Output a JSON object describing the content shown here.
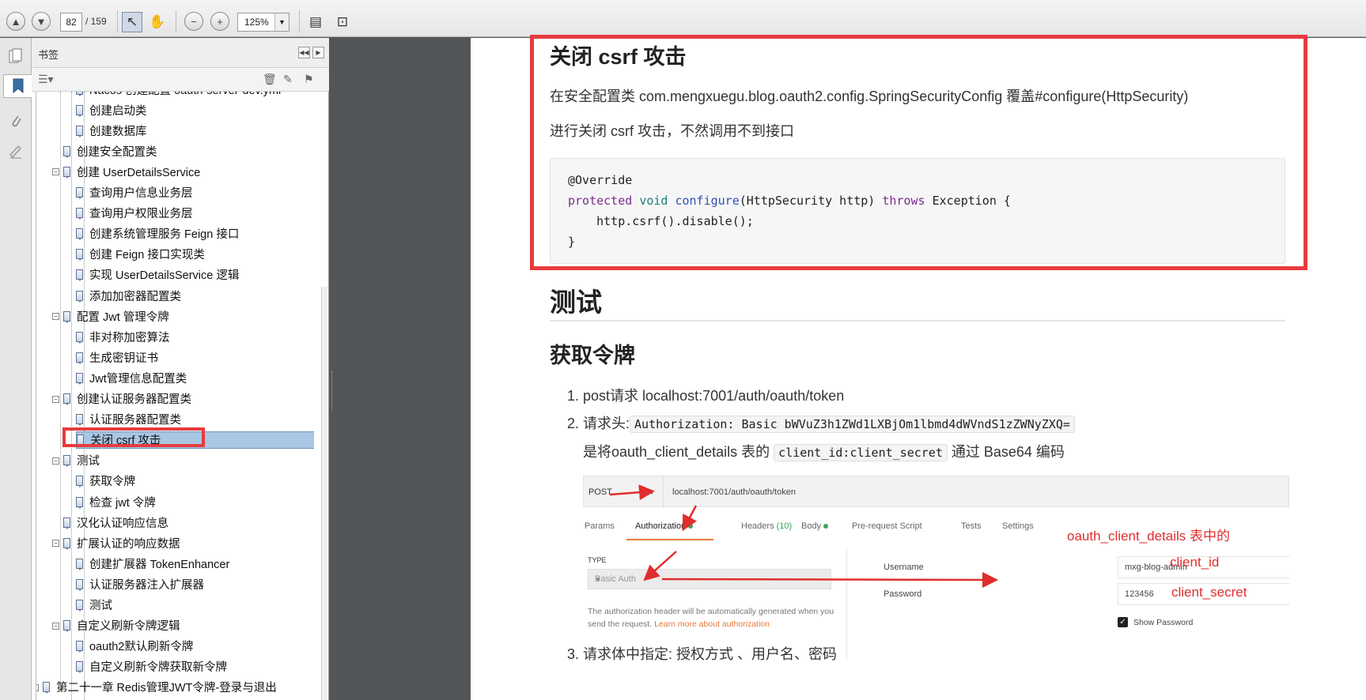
{
  "toolbar": {
    "page_current": "82",
    "page_total": "/ 159",
    "zoom": "125%",
    "zoom_caret": "▼",
    "up_glyph": "▲",
    "down_glyph": "▼",
    "select_glyph": "↖",
    "hand_glyph": "✋",
    "zoom_out_glyph": "−",
    "zoom_in_glyph": "+",
    "fit_page_glyph": "▤",
    "fit_width_glyph": "⊡"
  },
  "rail": {
    "icons": [
      "pages-icon",
      "bookmark-icon",
      "attachment-icon",
      "signature-icon"
    ]
  },
  "bookmarks": {
    "title": "书签",
    "collapse_glyph": "◀◀",
    "expand_glyph": "▶",
    "options_glyph": "☰▾",
    "delete_glyph": "🗑",
    "new_glyph": "✎",
    "find_glyph": "⚑",
    "items": [
      {
        "label": "Nacos 创建配置 oauth-server-dev.yml",
        "level": 2
      },
      {
        "label": "创建启动类",
        "level": 2
      },
      {
        "label": "创建数据库",
        "level": 2
      },
      {
        "label": "创建安全配置类",
        "level": 1
      },
      {
        "label": "创建 UserDetailsService",
        "level": 1,
        "toggle": "−"
      },
      {
        "label": "查询用户信息业务层",
        "level": 2
      },
      {
        "label": "查询用户权限业务层",
        "level": 2
      },
      {
        "label": "创建系统管理服务 Feign 接口",
        "level": 2
      },
      {
        "label": "创建 Feign 接口实现类",
        "level": 2
      },
      {
        "label": "实现 UserDetailsService 逻辑",
        "level": 2
      },
      {
        "label": "添加加密器配置类",
        "level": 2
      },
      {
        "label": "配置 Jwt 管理令牌",
        "level": 1,
        "toggle": "−"
      },
      {
        "label": "非对称加密算法",
        "level": 2
      },
      {
        "label": "生成密钥证书",
        "level": 2
      },
      {
        "label": "Jwt管理信息配置类",
        "level": 2
      },
      {
        "label": "创建认证服务器配置类",
        "level": 1,
        "toggle": "−"
      },
      {
        "label": "认证服务器配置类",
        "level": 2
      },
      {
        "label": "关闭 csrf 攻击",
        "level": 2,
        "selected": true
      },
      {
        "label": "测试",
        "level": 1,
        "toggle": "−"
      },
      {
        "label": "获取令牌",
        "level": 2
      },
      {
        "label": "检查 jwt 令牌",
        "level": 2
      },
      {
        "label": "汉化认证响应信息",
        "level": 1
      },
      {
        "label": "扩展认证的响应数据",
        "level": 1,
        "toggle": "−"
      },
      {
        "label": "创建扩展器 TokenEnhancer",
        "level": 2
      },
      {
        "label": "认证服务器注入扩展器",
        "level": 2
      },
      {
        "label": "测试",
        "level": 2
      },
      {
        "label": "自定义刷新令牌逻辑",
        "level": 1,
        "toggle": "−"
      },
      {
        "label": "oauth2默认刷新令牌",
        "level": 2
      },
      {
        "label": "自定义刷新令牌获取新令牌",
        "level": 2
      },
      {
        "label": "第二十一章  Redis管理JWT令牌-登录与退出",
        "level": 0,
        "toggle": "+"
      }
    ]
  },
  "doc": {
    "section_title": "关闭 csrf 攻击",
    "para1": "在安全配置类 com.mengxuegu.blog.oauth2.config.SpringSecurityConfig 覆盖#configure(HttpSecurity)",
    "para2": "进行关闭 csrf 攻击，不然调用不到接口",
    "code": {
      "line1": "@Override",
      "l2_protected": "protected",
      "l2_void": "void",
      "l2_fn": "configure",
      "l2_args": "(HttpSecurity http) ",
      "l2_throws": "throws",
      "l2_rest": " Exception {",
      "line3": "    http.csrf().disable();",
      "line4": "}"
    },
    "h1_test": "测试",
    "h2_get_token": "获取令牌",
    "li1": "1. post请求 localhost:7001/auth/oauth/token",
    "li2_prefix": "2. 请求头:",
    "li2_code": "Authorization: Basic bWVuZ3h1ZWd1LXBjOm1lbmd4dWVndS1zZWNyZXQ=",
    "li2b_prefix": "是将oauth_client_details 表的",
    "li2b_code": "client_id:client_secret",
    "li2b_suffix": "通过 Base64 编码",
    "li3": "3. 请求体中指定: 授权方式 、用户名、密码"
  },
  "screenshot": {
    "method": "POST",
    "method_caret": "▼",
    "url": "localhost:7001/auth/oauth/token",
    "tabs": {
      "params": "Params",
      "authorization": "Authorization",
      "headers": "Headers",
      "headers_count": "(10)",
      "body": "Body",
      "prerequest": "Pre-request Script",
      "tests": "Tests",
      "settings": "Settings"
    },
    "type_label": "TYPE",
    "type_value": "Basic Auth",
    "type_caret": "▼",
    "help_text": "The authorization header will be automatically generated when you send the request.",
    "help_link": "Learn more about authorization",
    "username_label": "Username",
    "username_value": "mxg-blog-admin",
    "password_label": "Password",
    "password_value": "123456",
    "check_glyph": "✓",
    "show_password": "Show Password",
    "anno_table": "oauth_client_details 表中的",
    "anno_client_id": "client_id",
    "anno_client_secret": "client_secret"
  },
  "colors": {
    "highlight_red": "#e63b3f",
    "selection_blue": "#a9c6e3",
    "postman_orange": "#e8773a",
    "postman_green": "#3aa35b"
  }
}
